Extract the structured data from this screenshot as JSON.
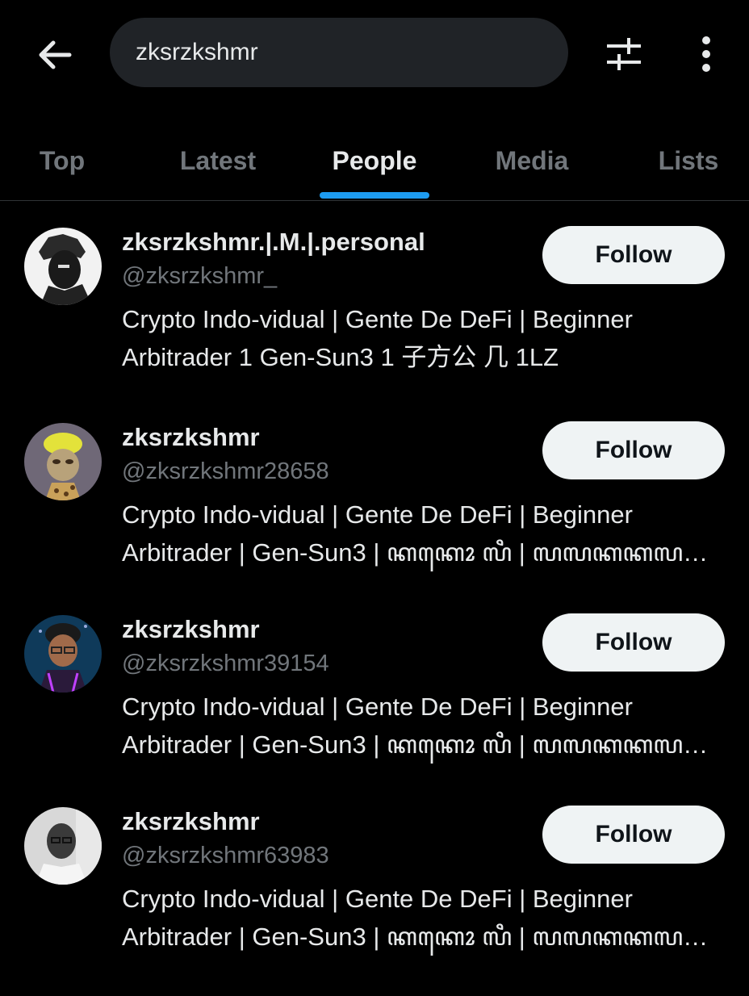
{
  "header": {
    "back_icon": "arrow-left-icon",
    "search_value": "zksrzkshmr",
    "filter_icon": "sliders-icon",
    "more_icon": "more-vertical-icon"
  },
  "tabs": [
    {
      "label": "Top",
      "active": false
    },
    {
      "label": "Latest",
      "active": false
    },
    {
      "label": "People",
      "active": true
    },
    {
      "label": "Media",
      "active": false
    },
    {
      "label": "Lists",
      "active": false
    }
  ],
  "colors": {
    "background": "#000000",
    "accent": "#1d9bf0",
    "muted_text": "#71767b",
    "follow_button_bg": "#eff3f4"
  },
  "people": [
    {
      "name": "zksrzkshmr.|.M.|.personal",
      "handle": "@zksrzkshmr_",
      "bio_line1": "Crypto Indo-vidual | Gente De DeFi | Beginner",
      "bio_line2": "Arbitrader 1 Gen-Sun3 1 子方公 几 1LZ",
      "follow_label": "Follow"
    },
    {
      "name": "zksrzkshmr",
      "handle": "@zksrzkshmr28658",
      "bio_line1": "Crypto Indo-vidual | Gente De DeFi | Beginner",
      "bio_line2": "Arbitrader | Gen-Sun3 | ꦏꦏꦺꦴ ꦭꦶ | ꦭꦭꦏꦏꦭ ꦺꦴꦭꦭꦸ ꦭ...",
      "follow_label": "Follow"
    },
    {
      "name": "zksrzkshmr",
      "handle": "@zksrzkshmr39154",
      "bio_line1": "Crypto Indo-vidual | Gente De DeFi | Beginner",
      "bio_line2": "Arbitrader | Gen-Sun3 | ꦏꦏꦺꦴ ꦭꦶ | ꦭꦭꦏꦏꦭ ꦺꦴꦭꦭꦸ ꦭ...",
      "follow_label": "Follow"
    },
    {
      "name": "zksrzkshmr",
      "handle": "@zksrzkshmr63983",
      "bio_line1": "Crypto Indo-vidual | Gente De DeFi | Beginner",
      "bio_line2": "Arbitrader | Gen-Sun3 | ꦏꦏꦺꦴ ꦭꦶ | ꦭꦭꦏꦏꦭ ꦺꦴꦭꦭꦸ ꦭ...",
      "follow_label": "Follow"
    }
  ]
}
